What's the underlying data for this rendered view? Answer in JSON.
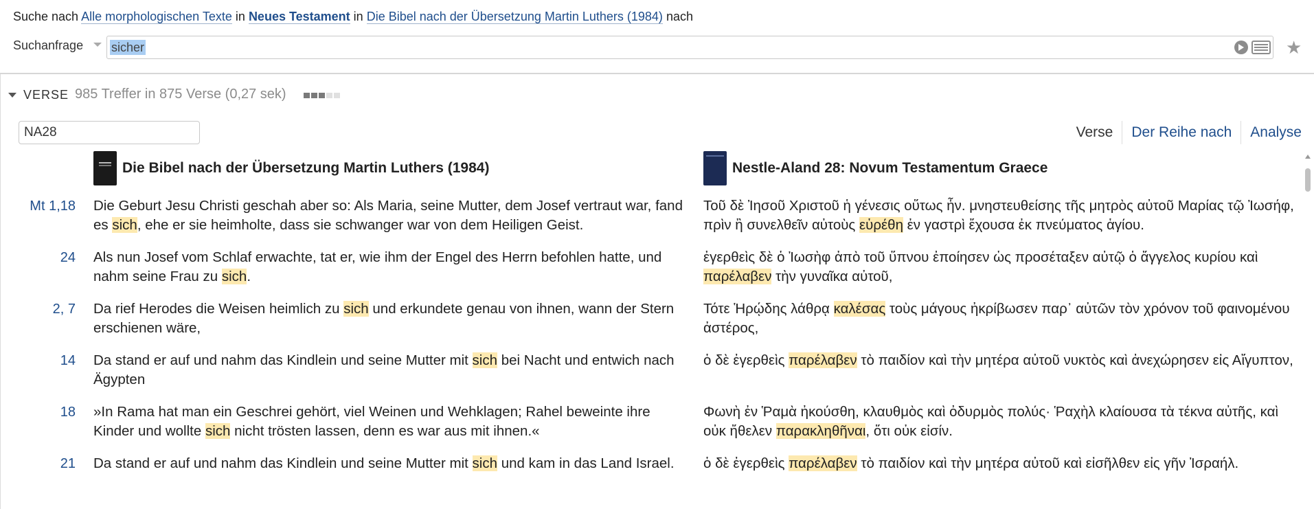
{
  "search_line": {
    "prefix": "Suche nach",
    "scope": "Alle morphologischen Texte",
    "in1": "in",
    "range": "Neues Testament",
    "in2": "in",
    "bible": "Die Bibel nach der Übersetzung Martin Luthers (1984)",
    "suffix": "nach"
  },
  "query": {
    "label": "Suchanfrage",
    "value": "sicher",
    "icons": [
      "go-icon",
      "keyboard-icon",
      "star-icon"
    ]
  },
  "results_header": {
    "title": "VERSE",
    "summary": "985 Treffer in 875 Verse (0,27 sek)",
    "progress_steps_on": 3,
    "progress_steps_total": 5
  },
  "filter": {
    "value": "NA28"
  },
  "view_tabs": [
    "Verse",
    "Der Reihe nach",
    "Analyse"
  ],
  "columns": {
    "left_title": "Die Bibel nach der Übersetzung Martin Luthers (1984)",
    "right_title": "Nestle-Aland 28: Novum Testamentum Graece"
  },
  "rows": [
    {
      "ref": "Mt 1,18",
      "de": [
        "Die Geburt Jesu Christi geschah aber so: Als Maria, seine Mutter, dem Josef vertraut war, fand es ",
        "sich",
        ", ehe er sie heimholte, dass sie schwanger war von dem Heiligen Geist."
      ],
      "gr": [
        "Τοῦ δὲ Ἰησοῦ Χριστοῦ ἡ γένεσις οὕτως ἦν. μνηστευθείσης τῆς μητρὸς αὐτοῦ Μαρίας τῷ Ἰωσήφ, πρὶν ἢ συνελθεῖν αὐτοὺς ",
        "εὑρέθη",
        " ἐν γαστρὶ ἔχουσα ἐκ πνεύματος ἁγίου."
      ]
    },
    {
      "ref": "24",
      "de": [
        "Als nun Josef vom Schlaf erwachte, tat er, wie ihm der Engel des Herrn befohlen hatte, und nahm seine Frau zu ",
        "sich",
        "."
      ],
      "gr": [
        "ἐγερθεὶς δὲ ὁ Ἰωσὴφ ἀπὸ τοῦ ὕπνου ἐποίησεν ὡς προσέταξεν αὐτῷ ὁ ἄγγελος κυρίου καὶ ",
        "παρέλαβεν",
        " τὴν γυναῖκα αὐτοῦ,"
      ]
    },
    {
      "ref": "2,  7",
      "de": [
        "Da rief Herodes die Weisen heimlich zu ",
        "sich",
        " und erkundete genau von ihnen, wann der Stern erschienen wäre,"
      ],
      "gr": [
        "Τότε Ἡρῴδης λάθρᾳ ",
        "καλέσας",
        " τοὺς μάγους ἠκρίβωσεν παρ᾽ αὐτῶν τὸν χρόνον τοῦ φαινομένου ἀστέρος,"
      ]
    },
    {
      "ref": "14",
      "de": [
        "Da stand er auf und nahm das Kindlein und seine Mutter mit ",
        "sich",
        " bei Nacht und entwich nach Ägypten"
      ],
      "gr": [
        "ὁ δὲ ἐγερθεὶς ",
        "παρέλαβεν",
        " τὸ παιδίον καὶ τὴν μητέρα αὐτοῦ νυκτὸς καὶ ἀνεχώρησεν εἰς Αἴγυπτον,"
      ]
    },
    {
      "ref": "18",
      "de": [
        "»In Rama hat man ein Geschrei gehört, viel Weinen und Wehklagen; Rahel beweinte ihre Kinder und wollte ",
        "sich",
        " nicht trösten lassen, denn es war aus mit ihnen.«"
      ],
      "gr": [
        "Φωνὴ ἐν Ῥαμὰ ἠκούσθη, κλαυθμὸς καὶ ὀδυρμὸς πολύς· Ῥαχὴλ κλαίουσα τὰ τέκνα αὐτῆς, καὶ οὐκ ἤθελεν ",
        "παρακληθῆναι",
        ", ὅτι οὐκ εἰσίν."
      ]
    },
    {
      "ref": "21",
      "de": [
        "Da stand er auf und nahm das Kindlein und seine Mutter mit ",
        "sich",
        " und kam in das Land Israel."
      ],
      "gr": [
        "ὁ δὲ ἐγερθεὶς ",
        "παρέλαβεν",
        " τὸ παιδίον καὶ τὴν μητέρα αὐτοῦ καὶ εἰσῆλθεν εἰς γῆν Ἰσραήλ."
      ]
    }
  ]
}
